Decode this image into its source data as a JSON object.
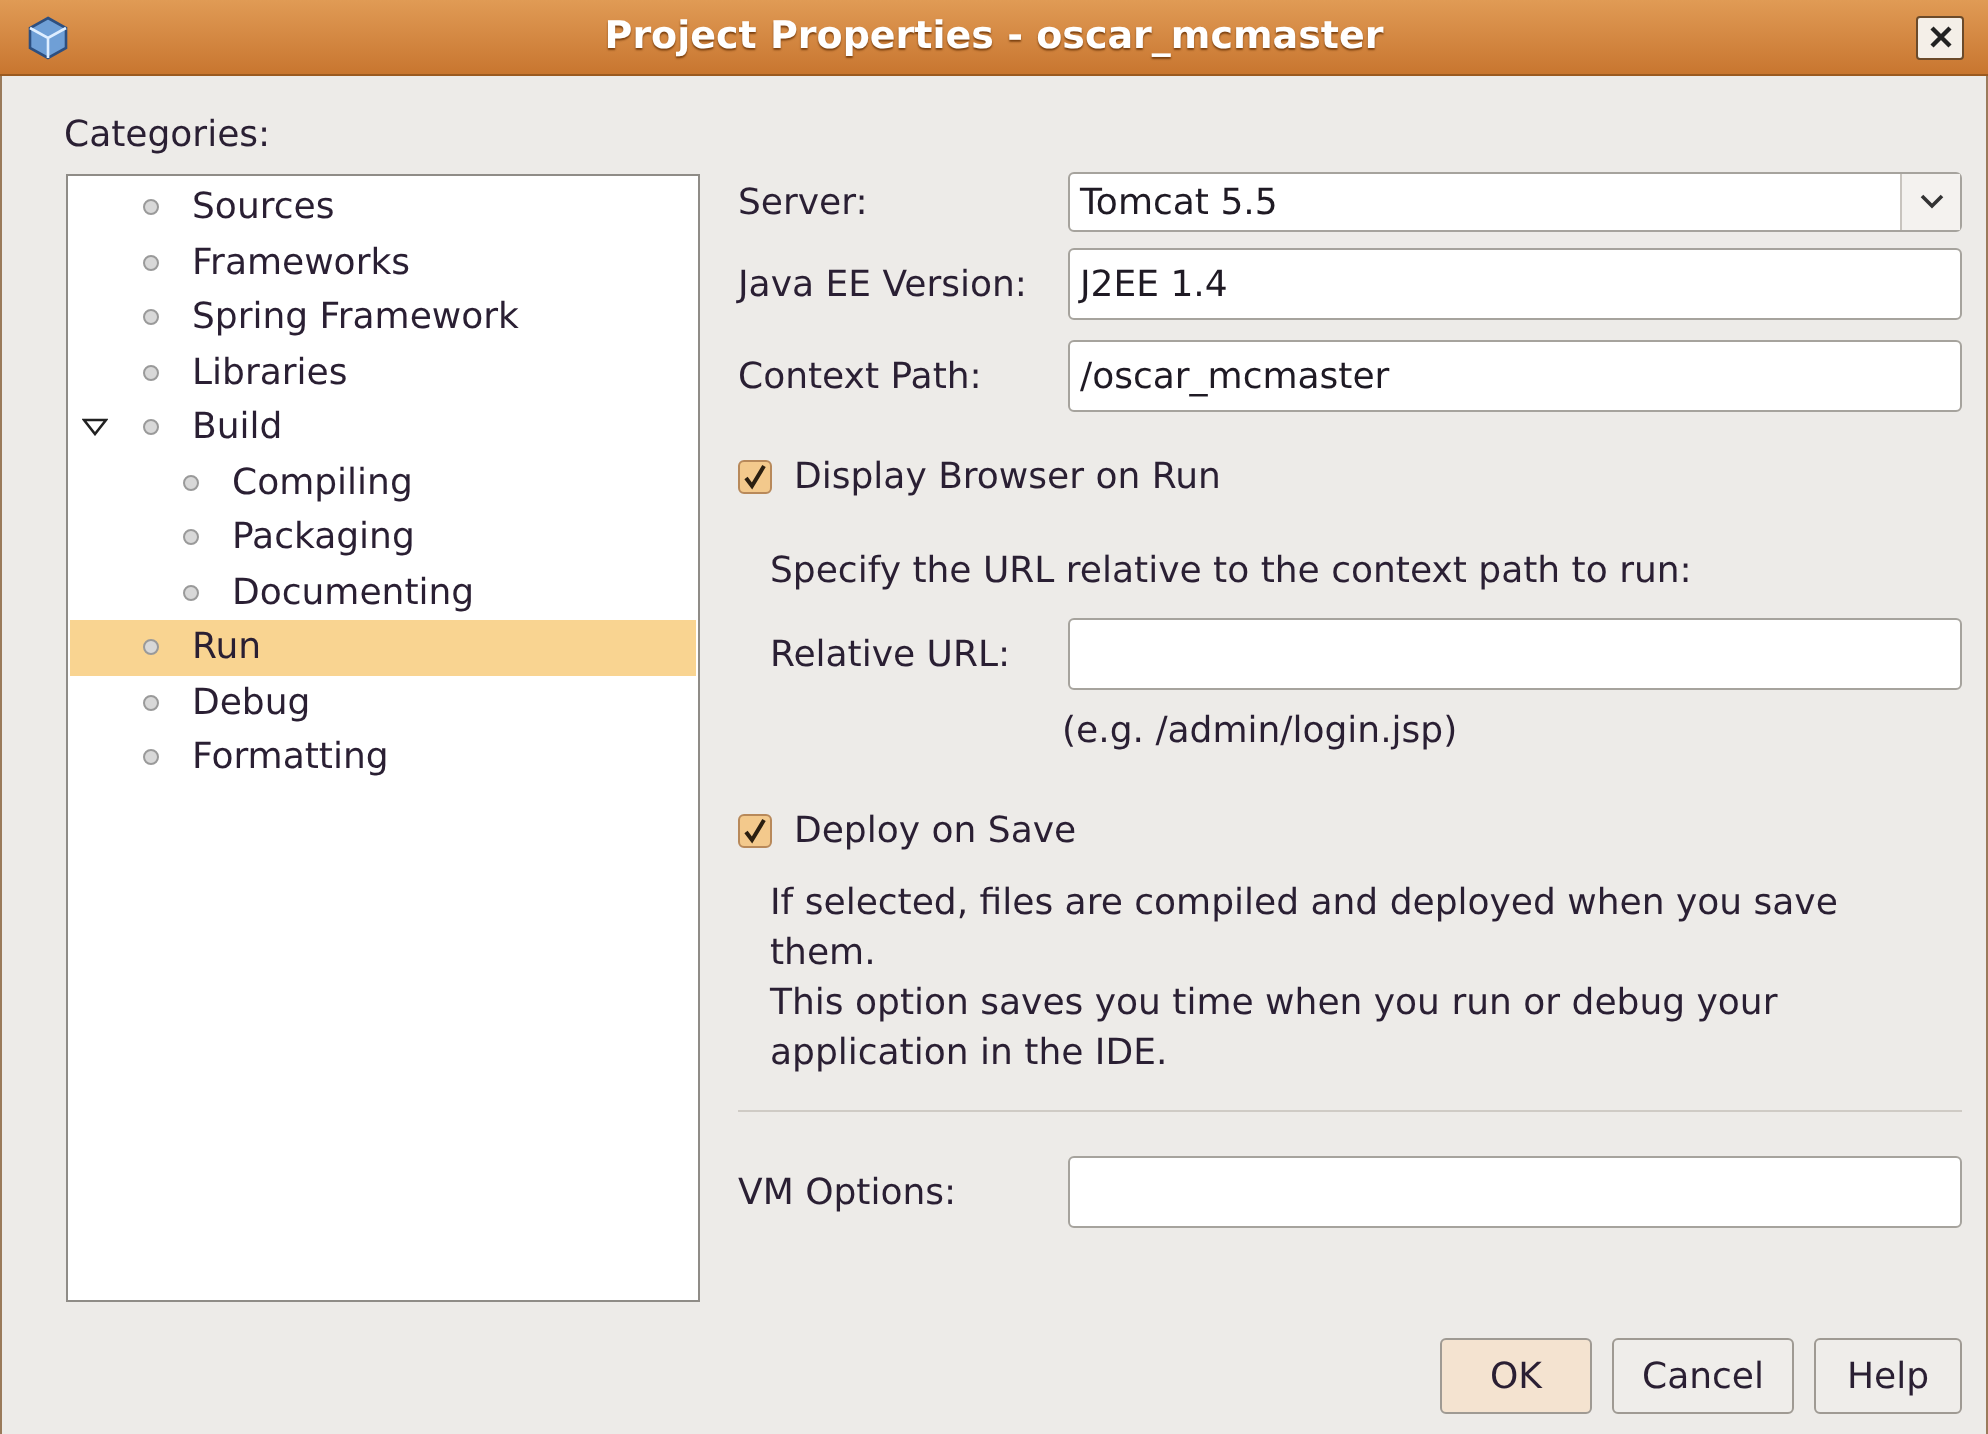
{
  "window": {
    "title": "Project Properties - oscar_mcmaster"
  },
  "categories": {
    "label": "Categories:",
    "items": [
      {
        "label": "Sources",
        "selected": false
      },
      {
        "label": "Frameworks",
        "selected": false
      },
      {
        "label": "Spring Framework",
        "selected": false
      },
      {
        "label": "Libraries",
        "selected": false
      },
      {
        "label": "Build",
        "selected": false,
        "expanded": true,
        "children": [
          {
            "label": "Compiling",
            "selected": false
          },
          {
            "label": "Packaging",
            "selected": false
          },
          {
            "label": "Documenting",
            "selected": false
          }
        ]
      },
      {
        "label": "Run",
        "selected": true
      },
      {
        "label": "Debug",
        "selected": false
      },
      {
        "label": "Formatting",
        "selected": false
      }
    ]
  },
  "server": {
    "label": "Server:",
    "value": "Tomcat 5.5"
  },
  "java_ee_version": {
    "label": "Java EE Version:",
    "value": "J2EE 1.4"
  },
  "context_path": {
    "label": "Context Path:",
    "value": "/oscar_mcmaster"
  },
  "display_browser": {
    "label": "Display Browser on Run",
    "checked": true
  },
  "url_hint": "Specify the URL relative to the context path to run:",
  "relative_url": {
    "label": "Relative URL:",
    "example": "(e.g. /admin/login.jsp)"
  },
  "deploy_on_save": {
    "label": "Deploy on Save",
    "checked": true,
    "description": [
      "If selected, files are compiled and deployed when you save them.",
      "This option saves you time when you run or debug your application in the IDE."
    ]
  },
  "vm_options": {
    "label": "VM Options:"
  },
  "buttons": [
    "OK",
    "Cancel",
    "Help"
  ]
}
